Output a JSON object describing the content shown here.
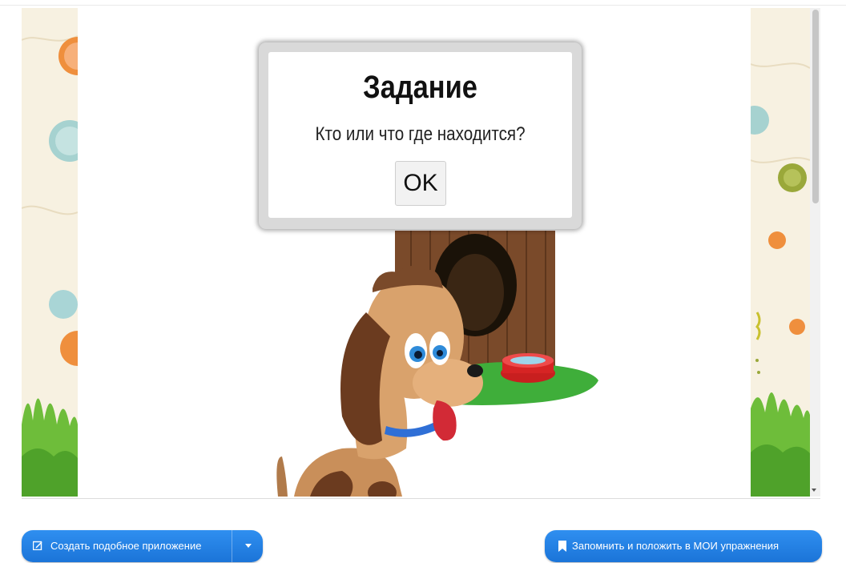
{
  "task_dialog": {
    "title": "Задание",
    "question": "Кто или что где находится?",
    "ok_label": "OK"
  },
  "buttons": {
    "create_app_label": "Создать подобное приложение",
    "save_label": "Запомнить и положить в МОИ упражнения"
  },
  "icons": {
    "create_app": "edit-icon",
    "dropdown": "caret-down-icon",
    "save": "bookmark-icon"
  },
  "colors": {
    "button_blue": "#1f7fe6",
    "panel_cream": "#f7f1e1"
  }
}
